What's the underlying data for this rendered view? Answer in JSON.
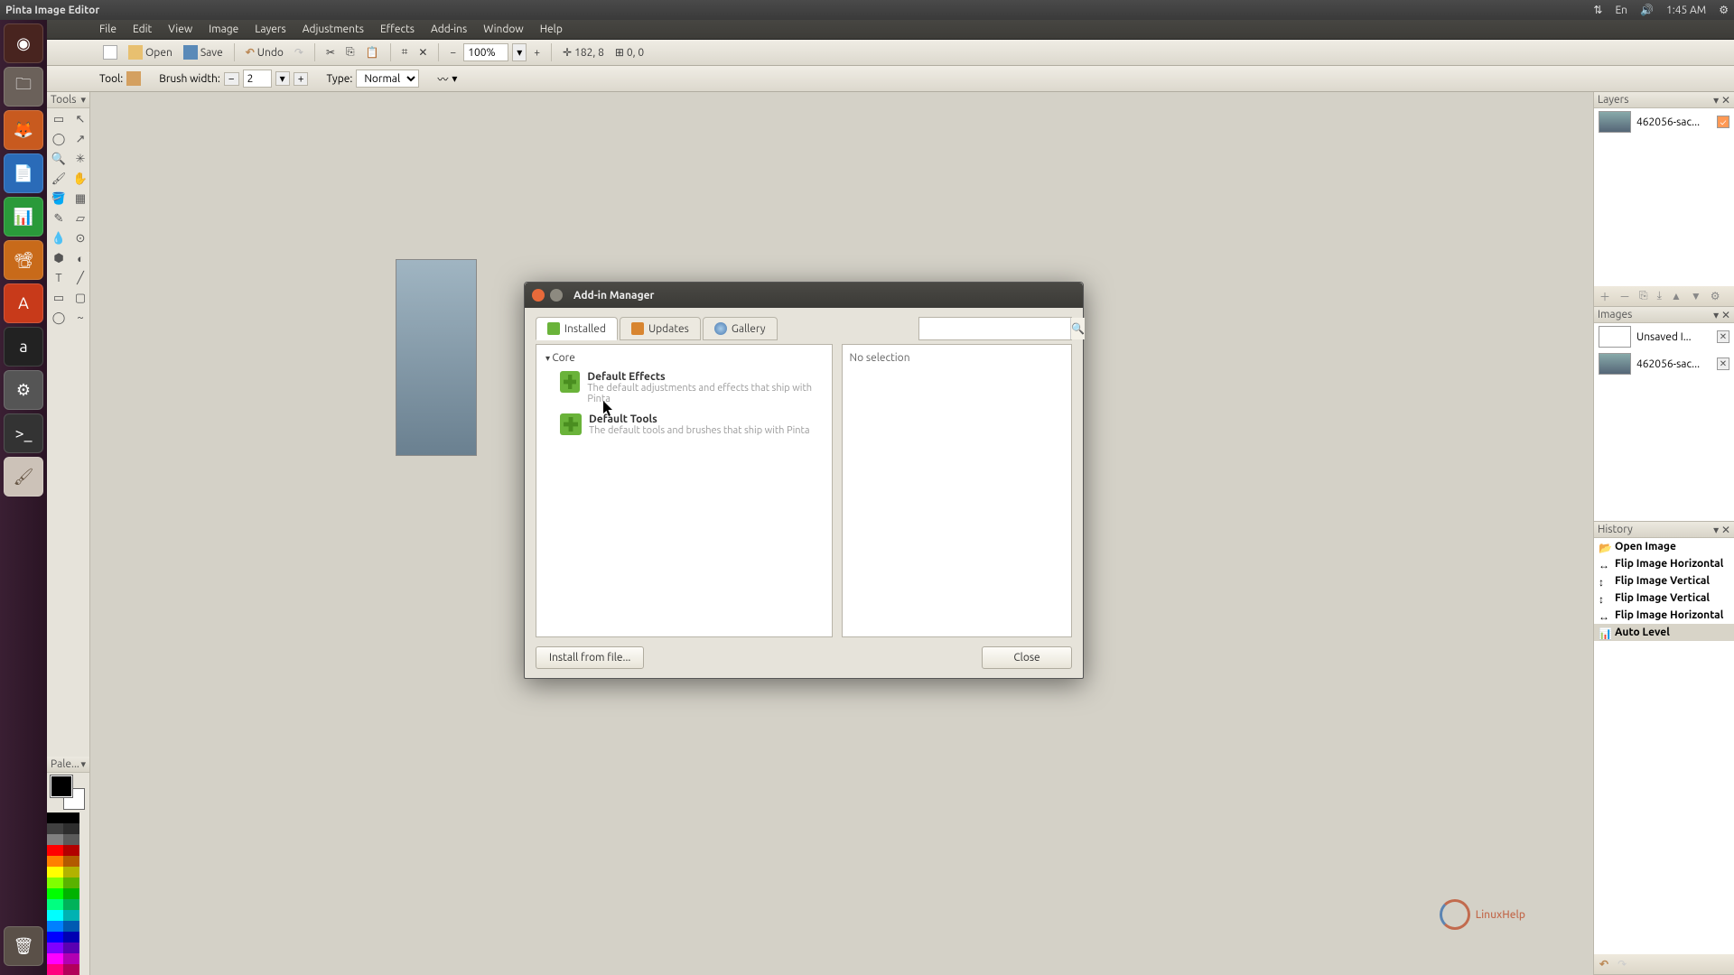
{
  "system": {
    "title": "Pinta Image Editor",
    "time": "1:45 AM",
    "keyboard": "En"
  },
  "menus": [
    "File",
    "Edit",
    "View",
    "Image",
    "Layers",
    "Adjustments",
    "Effects",
    "Add-ins",
    "Window",
    "Help"
  ],
  "toolbar": {
    "open": "Open",
    "save": "Save",
    "undo": "Undo",
    "zoom": "100%",
    "coords": "182, 8",
    "sel": "0, 0"
  },
  "tooloptions": {
    "tool_label": "Tool:",
    "brush_label": "Brush width:",
    "brush_value": "2",
    "type_label": "Type:",
    "type_value": "Normal"
  },
  "panels": {
    "tools_title": "Tools",
    "palette_title": "Pale...",
    "layers_title": "Layers",
    "images_title": "Images",
    "history_title": "History"
  },
  "layers": [
    {
      "name": "462056-sac..."
    }
  ],
  "images": [
    {
      "name": "Unsaved I...",
      "blank": true
    },
    {
      "name": "462056-sac...",
      "blank": false
    }
  ],
  "history": [
    {
      "label": "Open Image",
      "icon": "open"
    },
    {
      "label": "Flip Image Horizontal",
      "icon": "flip-h"
    },
    {
      "label": "Flip Image Vertical",
      "icon": "flip-v"
    },
    {
      "label": "Flip Image Vertical",
      "icon": "flip-v"
    },
    {
      "label": "Flip Image Horizontal",
      "icon": "flip-h"
    },
    {
      "label": "Auto Level",
      "icon": "autolevel",
      "selected": true
    }
  ],
  "dialog": {
    "title": "Add-in Manager",
    "tabs": {
      "installed": "Installed",
      "updates": "Updates",
      "gallery": "Gallery"
    },
    "category": "Core",
    "addins": [
      {
        "name": "Default Effects",
        "desc": "The default adjustments and effects that ship with Pinta"
      },
      {
        "name": "Default Tools",
        "desc": "The default tools and brushes that ship with Pinta"
      }
    ],
    "detail": "No selection",
    "install_btn": "Install from file...",
    "close_btn": "Close"
  },
  "watermark": "LinuxHelp",
  "palette_colors": [
    "#000000",
    "#404040",
    "#808080",
    "#ff0000",
    "#ff8000",
    "#ffff00",
    "#80ff00",
    "#00ff00",
    "#00ff80",
    "#00ffff",
    "#0080ff",
    "#0000ff",
    "#8000ff",
    "#ff00ff",
    "#ff0080"
  ]
}
